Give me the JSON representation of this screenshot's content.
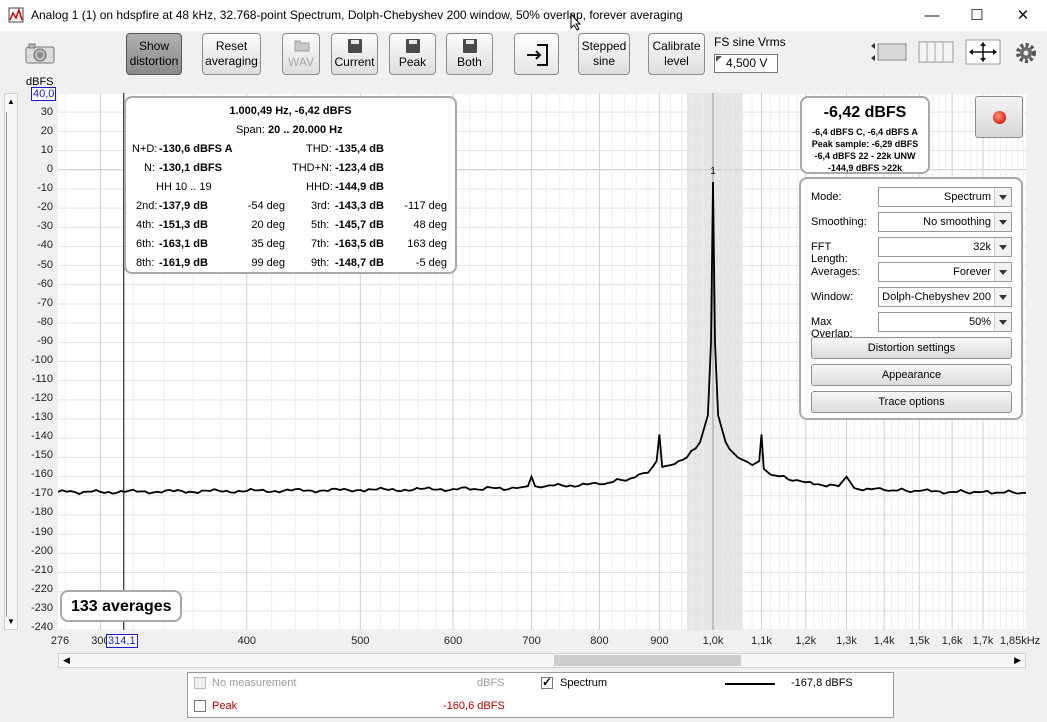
{
  "window": {
    "title": "Analog 1 (1) on hdspfire at 48 kHz, 32.768-point Spectrum, Dolph-Chebyshev 200 window, 50% overlap, forever averaging",
    "minimize": "—",
    "maximize": "☐",
    "close": "✕"
  },
  "toolbar": {
    "show_distortion": "Show distortion",
    "reset_averaging": "Reset averaging",
    "wav": "WAV",
    "current": "Current",
    "peak": "Peak",
    "both": "Both",
    "stepped_sine": "Stepped sine",
    "calibrate_level": "Calibrate level",
    "fs_label": "FS sine Vrms",
    "fs_value": "4,500 V"
  },
  "plot": {
    "y_unit": "dBFS",
    "y_top_value": "40,0",
    "x_cursor_value": "314,1",
    "averages": "133 averages",
    "y_ticks": [
      "30",
      "20",
      "10",
      "0",
      "-10",
      "-20",
      "-30",
      "-40",
      "-50",
      "-60",
      "-70",
      "-80",
      "-90",
      "-100",
      "-110",
      "-120",
      "-130",
      "-140",
      "-150",
      "-160",
      "-170",
      "-180",
      "-190",
      "-200",
      "-210",
      "-220",
      "-230",
      "-240"
    ],
    "x_ticks": [
      "276",
      "300",
      "400",
      "500",
      "600",
      "700",
      "800",
      "900",
      "1,0k",
      "1,1k",
      "1,2k",
      "1,3k",
      "1,4k",
      "1,5k",
      "1,6k",
      "1,7k",
      "1,85kHz"
    ],
    "peak_marker": "1"
  },
  "distortion": {
    "header": "1.000,49 Hz, -6,42 dBFS",
    "span_label": "Span:",
    "span_value": "20 .. 20.000 Hz",
    "nd_label": "N+D:",
    "nd_value": "-130,6 dBFS A",
    "thd_label": "THD:",
    "thd_value": "-135,4 dB",
    "n_label": "N:",
    "n_value": "-130,1 dBFS",
    "thdn_label": "THD+N:",
    "thdn_value": "-123,4 dB",
    "hh_label": "HH 10 .. 19",
    "hhd_label": "HHD:",
    "hhd_value": "-144,9 dB",
    "harmonics": [
      {
        "l1": "2nd:",
        "v1": "-137,9 dB",
        "d1": "-54 deg",
        "l2": "3rd:",
        "v2": "-143,3 dB",
        "d2": "-117 deg"
      },
      {
        "l1": "4th:",
        "v1": "-151,3 dB",
        "d1": "20 deg",
        "l2": "5th:",
        "v2": "-145,7 dB",
        "d2": "48 deg"
      },
      {
        "l1": "6th:",
        "v1": "-163,1 dB",
        "d1": "35 deg",
        "l2": "7th:",
        "v2": "-163,5 dB",
        "d2": "163 deg"
      },
      {
        "l1": "8th:",
        "v1": "-161,9 dB",
        "d1": "99 deg",
        "l2": "9th:",
        "v2": "-148,7 dB",
        "d2": "-5 deg"
      }
    ]
  },
  "level": {
    "main": "-6,42 dBFS",
    "line1": "-6,4 dBFS C, -6,4 dBFS A",
    "line2": "Peak sample: -6,29 dBFS",
    "line3": "-6,4 dBFS 22 - 22k UNW",
    "line4": "-144,9 dBFS >22k"
  },
  "controls": {
    "rows": [
      {
        "label": "Mode:",
        "value": "Spectrum"
      },
      {
        "label": "Smoothing:",
        "value": "No  smoothing"
      },
      {
        "label": "FFT Length:",
        "value": "32k"
      },
      {
        "label": "Averages:",
        "value": "Forever"
      },
      {
        "label": "Window:",
        "value": "Dolph-Chebyshev 200"
      },
      {
        "label": "Max Overlap:",
        "value": "50%"
      }
    ],
    "distortion_settings": "Distortion settings",
    "appearance": "Appearance",
    "trace_options": "Trace options"
  },
  "legend": {
    "no_measurement": "No measurement",
    "no_measurement_unit": "dBFS",
    "spectrum": "Spectrum",
    "spectrum_value": "-167,8 dBFS",
    "peak": "Peak",
    "peak_value": "-160,6 dBFS"
  },
  "colors": {
    "trace": "#000000",
    "peak_label": "#b00000",
    "record_led": "#e03020",
    "cursor_box": "#0000cc",
    "disabled": "#9a9a9a"
  },
  "chart_data": {
    "type": "line",
    "series": [
      {
        "name": "Spectrum",
        "x": [
          276,
          300,
          400,
          500,
          600,
          680,
          695,
          700,
          705,
          720,
          800,
          850,
          880,
          895,
          900,
          905,
          920,
          950,
          975,
          990,
          996,
          1000,
          1004,
          1010,
          1025,
          1050,
          1080,
          1095,
          1100,
          1105,
          1120,
          1200,
          1280,
          1300,
          1320,
          1400,
          1500,
          1600,
          1700,
          1850
        ],
        "y": [
          -168,
          -168,
          -167.5,
          -167,
          -166.5,
          -166,
          -165,
          -160,
          -165,
          -165,
          -164,
          -161,
          -158,
          -152,
          -138,
          -155,
          -154,
          -150,
          -142,
          -128,
          -90,
          -6.4,
          -90,
          -128,
          -142,
          -150,
          -154,
          -152,
          -138,
          -156,
          -159,
          -163,
          -165,
          -160,
          -166,
          -167,
          -167.5,
          -168,
          -168,
          -168.5
        ]
      }
    ],
    "xlim": [
      276,
      1850
    ],
    "ylim": [
      -240,
      40
    ],
    "xlabel": "",
    "ylabel": "dBFS",
    "grid": true,
    "log_x": true,
    "annotations": [
      "1"
    ]
  }
}
